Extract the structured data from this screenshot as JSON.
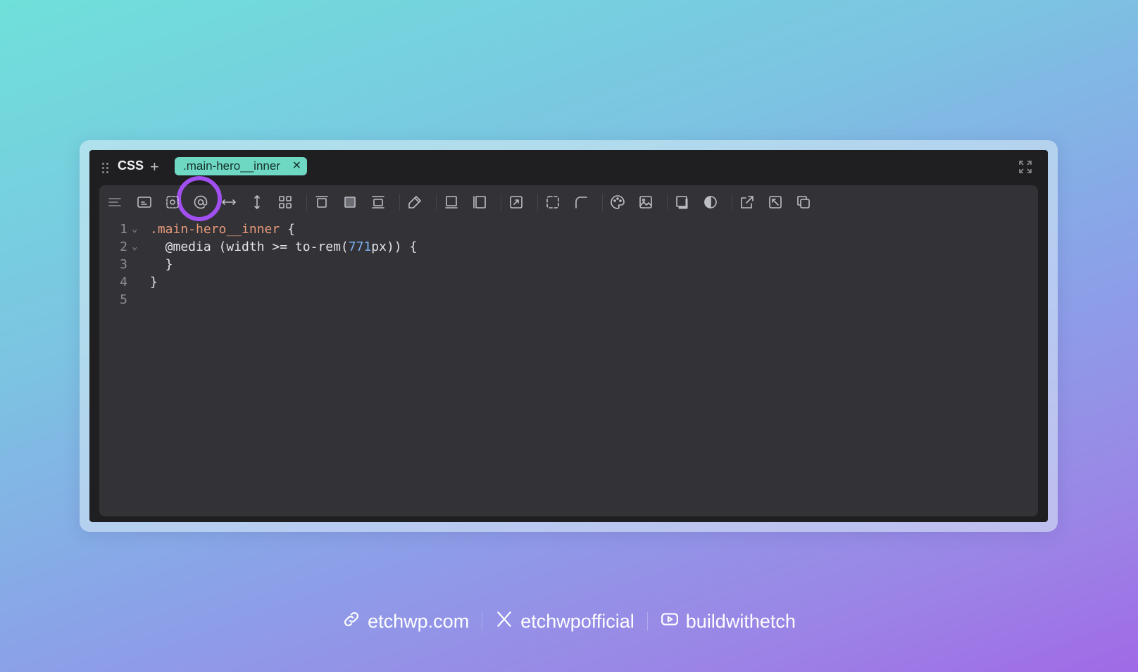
{
  "panel": {
    "title": "CSS",
    "tab_label": ".main-hero__inner"
  },
  "toolbar": {
    "icons": [
      "format-icon",
      "media-query-icon",
      "container-query-icon",
      "at-rule-icon",
      "width-icon",
      "height-icon",
      "grid-icon",
      "align-top-icon",
      "align-fill-icon",
      "align-bottom-icon",
      "color-picker-icon",
      "border-bottom-icon",
      "border-left-icon",
      "position-icon",
      "outline-icon",
      "radius-icon",
      "palette-icon",
      "image-icon",
      "shadow-icon",
      "contrast-icon",
      "external-link-icon",
      "resize-icon",
      "copy-icon"
    ],
    "highlighted": "at-rule-icon"
  },
  "code": {
    "lines": [
      {
        "num": "1",
        "fold": true,
        "parts": [
          {
            "t": ".main-hero__inner",
            "c": "sel"
          },
          {
            "t": " {",
            "c": ""
          }
        ]
      },
      {
        "num": "2",
        "fold": true,
        "parts": [
          {
            "t": "  @media (width >= to-rem(",
            "c": ""
          },
          {
            "t": "771",
            "c": "num"
          },
          {
            "t": "px)) {",
            "c": ""
          }
        ]
      },
      {
        "num": "3",
        "fold": false,
        "parts": [
          {
            "t": "  }",
            "c": ""
          }
        ]
      },
      {
        "num": "4",
        "fold": false,
        "parts": [
          {
            "t": "}",
            "c": ""
          }
        ]
      },
      {
        "num": "5",
        "fold": false,
        "parts": []
      }
    ]
  },
  "footer": {
    "website": "etchwp.com",
    "x_handle": "etchwpofficial",
    "youtube": "buildwithetch"
  },
  "colors": {
    "accent_tab": "#6fd8c3",
    "highlight": "#a24ff0",
    "selector": "#e89a7a",
    "number": "#7cb3f0"
  }
}
